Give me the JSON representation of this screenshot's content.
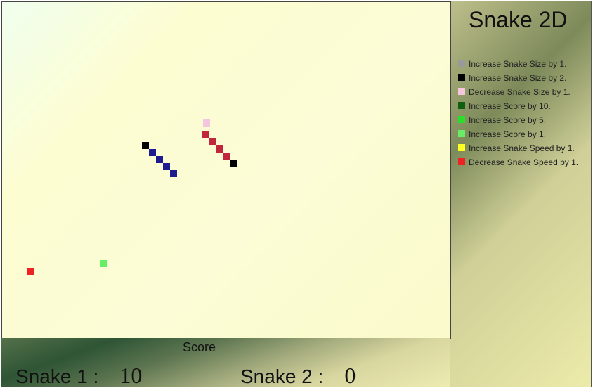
{
  "title": "Snake 2D",
  "legend": [
    {
      "color": "#9a9a9a",
      "label": "Increase Snake Size by 1."
    },
    {
      "color": "#000000",
      "label": "Increase Snake Size by 2."
    },
    {
      "color": "#f5c6dd",
      "label": "Decrease Snake Size by 1."
    },
    {
      "color": "#0f5f0f",
      "label": "Increase Score by 10."
    },
    {
      "color": "#2bde2b",
      "label": "Increase Score by 5."
    },
    {
      "color": "#66ee66",
      "label": "Increase Score by 1."
    },
    {
      "color": "#ffff22",
      "label": "Increase Snake Speed by 1."
    },
    {
      "color": "#ee2222",
      "label": "Decrease Snake Speed by 1."
    }
  ],
  "score": {
    "heading": "Score",
    "snake1_label": "Snake 1 :",
    "snake1_value": "10",
    "snake2_label": "Snake 2 :",
    "snake2_value": "0"
  },
  "colors": {
    "snake1_body": "#1e1b8f",
    "snake2_body": "#c0273d",
    "snake_head": "#000000"
  }
}
